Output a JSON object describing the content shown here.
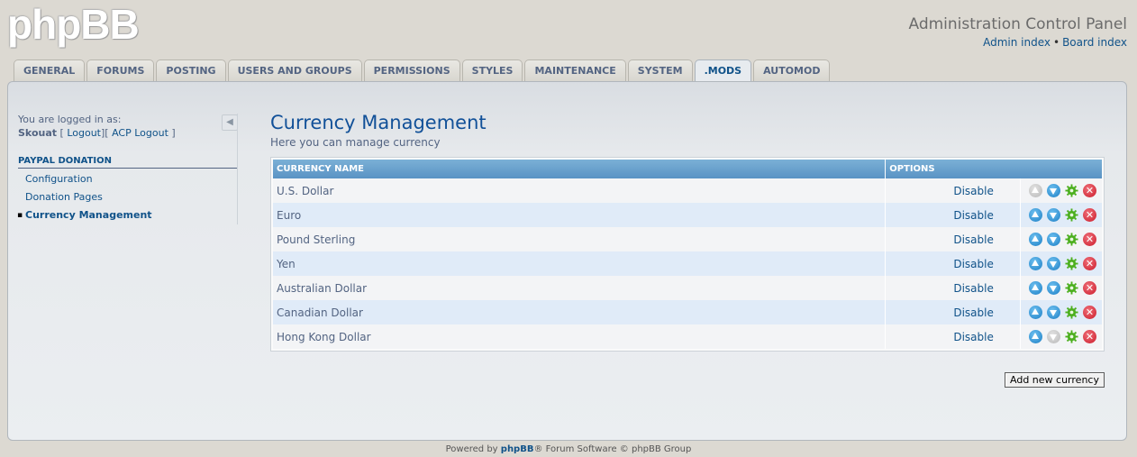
{
  "header": {
    "logo": "phpBB",
    "title": "Administration Control Panel",
    "links": {
      "admin_index": "Admin index",
      "separator": "•",
      "board_index": "Board index"
    }
  },
  "tabs": [
    {
      "label": "GENERAL"
    },
    {
      "label": "FORUMS"
    },
    {
      "label": "POSTING"
    },
    {
      "label": "USERS AND GROUPS"
    },
    {
      "label": "PERMISSIONS"
    },
    {
      "label": "STYLES"
    },
    {
      "label": "MAINTENANCE"
    },
    {
      "label": "SYSTEM"
    },
    {
      "label": ".MODS",
      "active": true
    },
    {
      "label": "AUTOMOD"
    }
  ],
  "sidebar": {
    "logged_in_as": "You are logged in as:",
    "username": "Skouat",
    "logout_open": "[",
    "logout": "Logout",
    "acp_logout_open": "][",
    "acp_logout": "ACP Logout",
    "acp_logout_close": "]",
    "menu_header": "PAYPAL DONATION",
    "items": [
      {
        "label": "Configuration"
      },
      {
        "label": "Donation Pages"
      },
      {
        "label": "Currency Management",
        "active": true
      }
    ]
  },
  "main": {
    "title": "Currency Management",
    "description": "Here you can manage currency",
    "table": {
      "headers": [
        "CURRENCY NAME",
        "OPTIONS"
      ],
      "rows": [
        {
          "name": "U.S. Dollar",
          "status": "Disable",
          "up_enabled": false,
          "down_enabled": true
        },
        {
          "name": "Euro",
          "status": "Disable",
          "up_enabled": true,
          "down_enabled": true
        },
        {
          "name": "Pound Sterling",
          "status": "Disable",
          "up_enabled": true,
          "down_enabled": true
        },
        {
          "name": "Yen",
          "status": "Disable",
          "up_enabled": true,
          "down_enabled": true
        },
        {
          "name": "Australian Dollar",
          "status": "Disable",
          "up_enabled": true,
          "down_enabled": true
        },
        {
          "name": "Canadian Dollar",
          "status": "Disable",
          "up_enabled": true,
          "down_enabled": true
        },
        {
          "name": "Hong Kong Dollar",
          "status": "Disable",
          "up_enabled": true,
          "down_enabled": false
        }
      ]
    },
    "add_button": "Add new currency"
  },
  "footer": {
    "powered_by": "Powered by",
    "brand": "phpBB",
    "rest": "® Forum Software © phpBB Group"
  },
  "icons": {
    "collapse": "arrow-left-icon",
    "move_up": "arrow-up-icon",
    "move_down": "arrow-down-icon",
    "edit": "gear-icon",
    "delete": "delete-icon"
  },
  "colors": {
    "accent": "#105289",
    "header_bar": "#5a93c4",
    "row_alt": "#e0ebf8",
    "delete": "#cb1b2a",
    "gear": "#4caf1e"
  }
}
